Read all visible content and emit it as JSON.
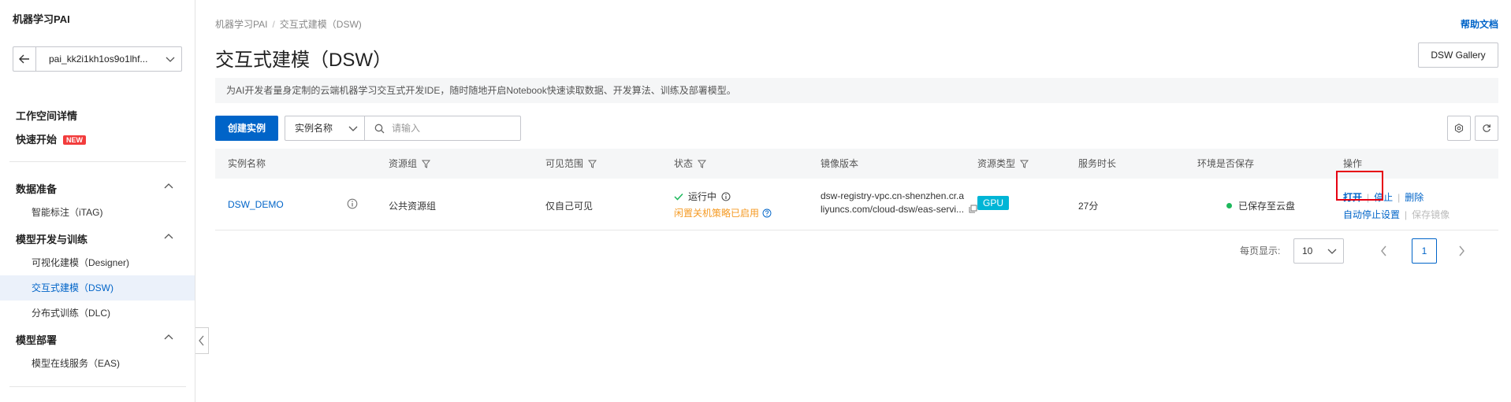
{
  "app": {
    "title": "机器学习PAI"
  },
  "workspace": {
    "name": "pai_kk2i1kh1os9o1lhf..."
  },
  "sidebar": {
    "workspace_detail": "工作空间详情",
    "quick_start": "快速开始",
    "new_badge": "NEW",
    "groups": [
      {
        "title": "数据准备",
        "items": [
          {
            "label": "智能标注（iTAG)"
          }
        ]
      },
      {
        "title": "模型开发与训练",
        "items": [
          {
            "label": "可视化建模（Designer)"
          },
          {
            "label": "交互式建模（DSW)"
          },
          {
            "label": "分布式训练（DLC)"
          }
        ]
      },
      {
        "title": "模型部署",
        "items": [
          {
            "label": "模型在线服务（EAS)"
          }
        ]
      }
    ]
  },
  "header": {
    "breadcrumb": [
      "机器学习PAI",
      "交互式建模（DSW)"
    ],
    "help": "帮助文档",
    "title": "交互式建模（DSW）",
    "gallery_button": "DSW Gallery",
    "description": "为AI开发者量身定制的云端机器学习交互式开发IDE，随时随地开启Notebook快速读取数据、开发算法、训练及部署模型。"
  },
  "toolbar": {
    "create_button": "创建实例",
    "filter_selected": "实例名称",
    "search_placeholder": "请输入"
  },
  "table": {
    "headers": [
      "实例名称",
      "资源组",
      "可见范围",
      "状态",
      "镜像版本",
      "资源类型",
      "服务时长",
      "环境是否保存",
      "操作"
    ],
    "rows": [
      {
        "name": "DSW_DEMO",
        "resource_group": "公共资源组",
        "visibility": "仅自己可见",
        "status": "运行中",
        "status_sub": "闲置关机策略已启用",
        "image_line1": "dsw-registry-vpc.cn-shenzhen.cr.a",
        "image_line2": "liyuncs.com/cloud-dsw/eas-servi...",
        "resource_type": "GPU",
        "duration": "27分",
        "env_saved": "已保存至云盘",
        "ops": {
          "open": "打开",
          "stop": "停止",
          "delete": "删除",
          "auto_stop": "自动停止设置",
          "save_image": "保存镜像"
        }
      }
    ]
  },
  "pagination": {
    "per_page_label": "每页显示:",
    "page_size": "10",
    "current_page": "1"
  },
  "colors": {
    "primary": "#0064c8",
    "warning": "#f59a23",
    "success": "#1db85c",
    "gpu": "#00b5d6",
    "highlight_box": "#e60012"
  }
}
